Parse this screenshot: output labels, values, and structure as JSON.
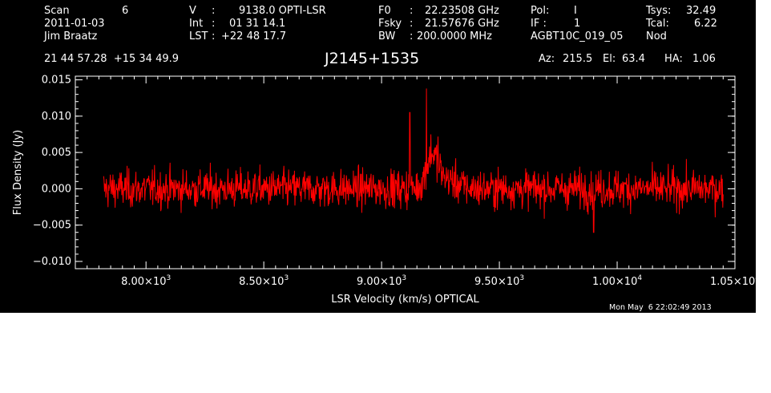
{
  "header": {
    "scan_label": "Scan",
    "scan_value": "6",
    "date": "2011-01-03",
    "observer": "Jim Braatz",
    "coords": "21 44 57.28  +15 34 49.9",
    "v_label": "V",
    "v_value": "9138.0 OPTI-LSR",
    "int_label": "Int",
    "int_value": "01 31 14.1",
    "lst_label": "LST",
    "lst_value": "+22 48 17.7",
    "f0_label": "F0",
    "f0_value": "22.23508 GHz",
    "fsky_label": "Fsky",
    "fsky_value": "21.57676 GHz",
    "bw_label": "BW",
    "bw_value": "200.0000 MHz",
    "pol_label": "Pol:",
    "pol_value": "I",
    "if_label": "IF :",
    "if_value": "1",
    "project": "AGBT10C_019_05",
    "tsys_label": "Tsys:",
    "tsys_value": "32.49",
    "tcal_label": "Tcal:",
    "tcal_value": "6.22",
    "proc": "Nod",
    "source": "J2145+1535",
    "az_label": "Az:",
    "az_value": "215.5",
    "el_label": "El:",
    "el_value": "63.4",
    "ha_label": "HA:",
    "ha_value": "1.06"
  },
  "footer": {
    "timestamp": "Mon May  6 22:02:49 2013"
  },
  "colors": {
    "background": "#000000",
    "axes": "#ffffff",
    "series": "#ff0000"
  },
  "chart_data": {
    "type": "line",
    "xlabel": "LSR Velocity (km/s) OPTICAL",
    "ylabel": "Flux Density (Jy)",
    "xlim": [
      7700,
      10500
    ],
    "ylim": [
      -0.011,
      0.0155
    ],
    "x_ticks": [
      {
        "value": 8000,
        "mantissa": "8.00×10",
        "exp": "3"
      },
      {
        "value": 8500,
        "mantissa": "8.50×10",
        "exp": "3"
      },
      {
        "value": 9000,
        "mantissa": "9.00×10",
        "exp": "3"
      },
      {
        "value": 9500,
        "mantissa": "9.50×10",
        "exp": "3"
      },
      {
        "value": 10000,
        "mantissa": "1.00×10",
        "exp": "4"
      },
      {
        "value": 10500,
        "mantissa": "1.05×10",
        "exp": "4"
      }
    ],
    "y_ticks": [
      {
        "value": -0.01,
        "label": "−0.010"
      },
      {
        "value": -0.005,
        "label": "−0.005"
      },
      {
        "value": 0.0,
        "label": "0.000"
      },
      {
        "value": 0.005,
        "label": "0.005"
      },
      {
        "value": 0.01,
        "label": "0.010"
      },
      {
        "value": 0.015,
        "label": "0.015"
      }
    ],
    "series": [
      {
        "x_range": [
          7820,
          10450
        ],
        "noise_rms_jy": 0.0013,
        "features": [
          {
            "x": 9120,
            "y": 0.0105
          },
          {
            "x": 9190,
            "y": 0.0138
          },
          {
            "x": 9210,
            "y": 0.0075
          },
          {
            "x": 9240,
            "y": 0.0072
          },
          {
            "x": 9900,
            "y": -0.006
          }
        ]
      }
    ]
  }
}
